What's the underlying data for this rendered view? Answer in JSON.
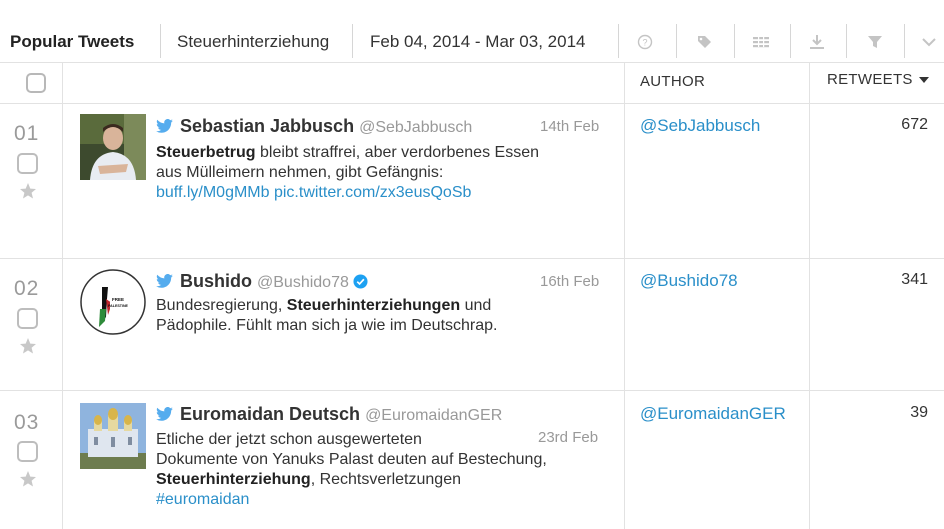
{
  "toolbar": {
    "title": "Popular Tweets",
    "search_term": "Steuerhinterziehung",
    "date_range": "Feb 04, 2014 - Mar 03, 2014",
    "icons": [
      "help-icon",
      "tag-icon",
      "columns-icon",
      "download-icon",
      "filter-icon",
      "chevron-down-icon"
    ]
  },
  "table": {
    "author_header": "AUTHOR",
    "retweets_header": "RETWEETS",
    "sort": "descending"
  },
  "rows": [
    {
      "rank": "01",
      "name": "Sebastian Jabbusch",
      "handle": "@SebJabbusch",
      "date": "14th Feb",
      "text_bold": "Steuerbetrug",
      "text_line1": " bleibt straffrei, aber verdorbenes Essen",
      "text_line2": "aus Mülleimern nehmen, gibt Gefängnis:",
      "text_line3": "buff.ly/M0gMMb pic.twitter.com/zx3eusQoSb",
      "author": "@SebJabbusch",
      "retweets": "672",
      "verified": false
    },
    {
      "rank": "02",
      "name": "Bushido",
      "handle": "@Bushido78",
      "date": "16th Feb",
      "text_line1_a": "Bundesregierung, ",
      "text_bold": "Steuerhinterziehungen",
      "text_line1_b": " und",
      "text_line2": "Pädophile. Fühlt man sich ja wie im Deutschrap.",
      "author": "@Bushido78",
      "retweets": "341",
      "verified": true,
      "avatar_text": "FREE PALESTINE"
    },
    {
      "rank": "03",
      "name": "Euromaidan Deutsch",
      "handle": "@EuromaidanGER",
      "date": "23rd Feb",
      "text_line1": "Etliche der jetzt schon ausgewerteten",
      "text_line2": "Dokumente von Yanuks Palast deuten auf Bestechung,",
      "text_bold": "Steuerhinterziehung",
      "text_line3_rest": ", Rechtsverletzungen",
      "text_line4": "#euromaidan",
      "author": "@EuromaidanGER",
      "retweets": "39",
      "verified": false
    }
  ],
  "colors": {
    "link": "#2a8fc9",
    "twitter_bird": "#55acee",
    "verified": "#1da1f2",
    "muted": "#999999",
    "border": "#e2e2e2"
  }
}
